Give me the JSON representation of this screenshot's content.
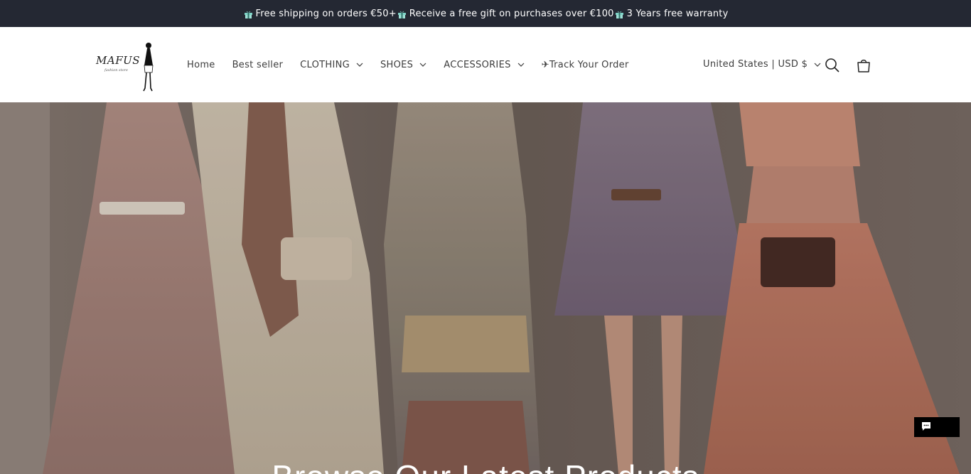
{
  "announcement": {
    "segments": [
      "Free shipping on orders €50+",
      "Receive a free gift on purchases over €100",
      "3 Years free warranty"
    ],
    "icon": "gift-icon"
  },
  "header": {
    "logo": {
      "wordmark": "MAFUS",
      "tagline": "fashion store"
    },
    "nav": {
      "home": "Home",
      "best_seller": "Best seller",
      "clothing": "CLOTHING",
      "shoes": "SHOES",
      "accessories": "ACCESSORIES",
      "track_order": "✈Track Your Order"
    },
    "locale": "United States | USD $",
    "icons": {
      "search": "search-icon",
      "cart": "cart-icon",
      "chevron": "chevron-down-icon"
    }
  },
  "hero": {
    "title": "Browse Our Latest Products"
  },
  "chat": {
    "icon": "chat-icon"
  },
  "colors": {
    "announcement_bg": "#242833",
    "header_bg": "#ffffff",
    "text": "#3d3d3d",
    "chat_bg": "#000000"
  }
}
